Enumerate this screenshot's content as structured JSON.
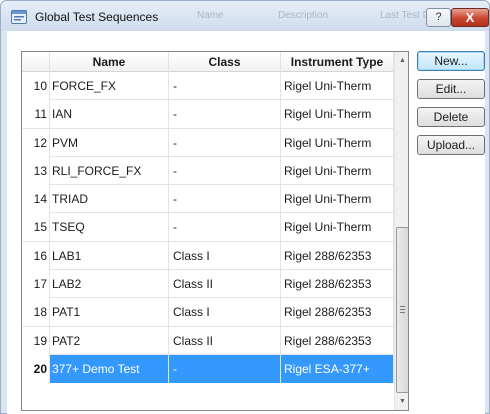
{
  "window": {
    "title": "Global Test Sequences",
    "ghost_headers": [
      "Name",
      "Description",
      "Last Test Date"
    ],
    "help_label": "?",
    "close_label": "X"
  },
  "table": {
    "columns": [
      "Name",
      "Class",
      "Instrument Type"
    ],
    "rows": [
      {
        "num": "10",
        "name": "FORCE_FX",
        "class": "-",
        "type": "Rigel Uni-Therm"
      },
      {
        "num": "11",
        "name": "IAN",
        "class": "-",
        "type": "Rigel Uni-Therm"
      },
      {
        "num": "12",
        "name": "PVM",
        "class": "-",
        "type": "Rigel Uni-Therm"
      },
      {
        "num": "13",
        "name": "RLI_FORCE_FX",
        "class": "-",
        "type": "Rigel Uni-Therm"
      },
      {
        "num": "14",
        "name": "TRIAD",
        "class": "-",
        "type": "Rigel Uni-Therm"
      },
      {
        "num": "15",
        "name": "TSEQ",
        "class": "-",
        "type": "Rigel Uni-Therm"
      },
      {
        "num": "16",
        "name": "LAB1",
        "class": "Class I",
        "type": "Rigel 288/62353"
      },
      {
        "num": "17",
        "name": "LAB2",
        "class": "Class II",
        "type": "Rigel 288/62353"
      },
      {
        "num": "18",
        "name": "PAT1",
        "class": "Class I",
        "type": "Rigel 288/62353"
      },
      {
        "num": "19",
        "name": "PAT2",
        "class": "Class II",
        "type": "Rigel 288/62353"
      },
      {
        "num": "20",
        "name": "377+ Demo Test",
        "class": "-",
        "type": "Rigel ESA-377+"
      }
    ],
    "selected_row": "20"
  },
  "buttons": {
    "new_label": "New...",
    "edit_label": "Edit...",
    "delete_label": "Delete",
    "upload_label": "Upload..."
  },
  "colors": {
    "selection": "#3399ff",
    "window_frame": "#dce6f1",
    "close_button": "#c9462f"
  }
}
